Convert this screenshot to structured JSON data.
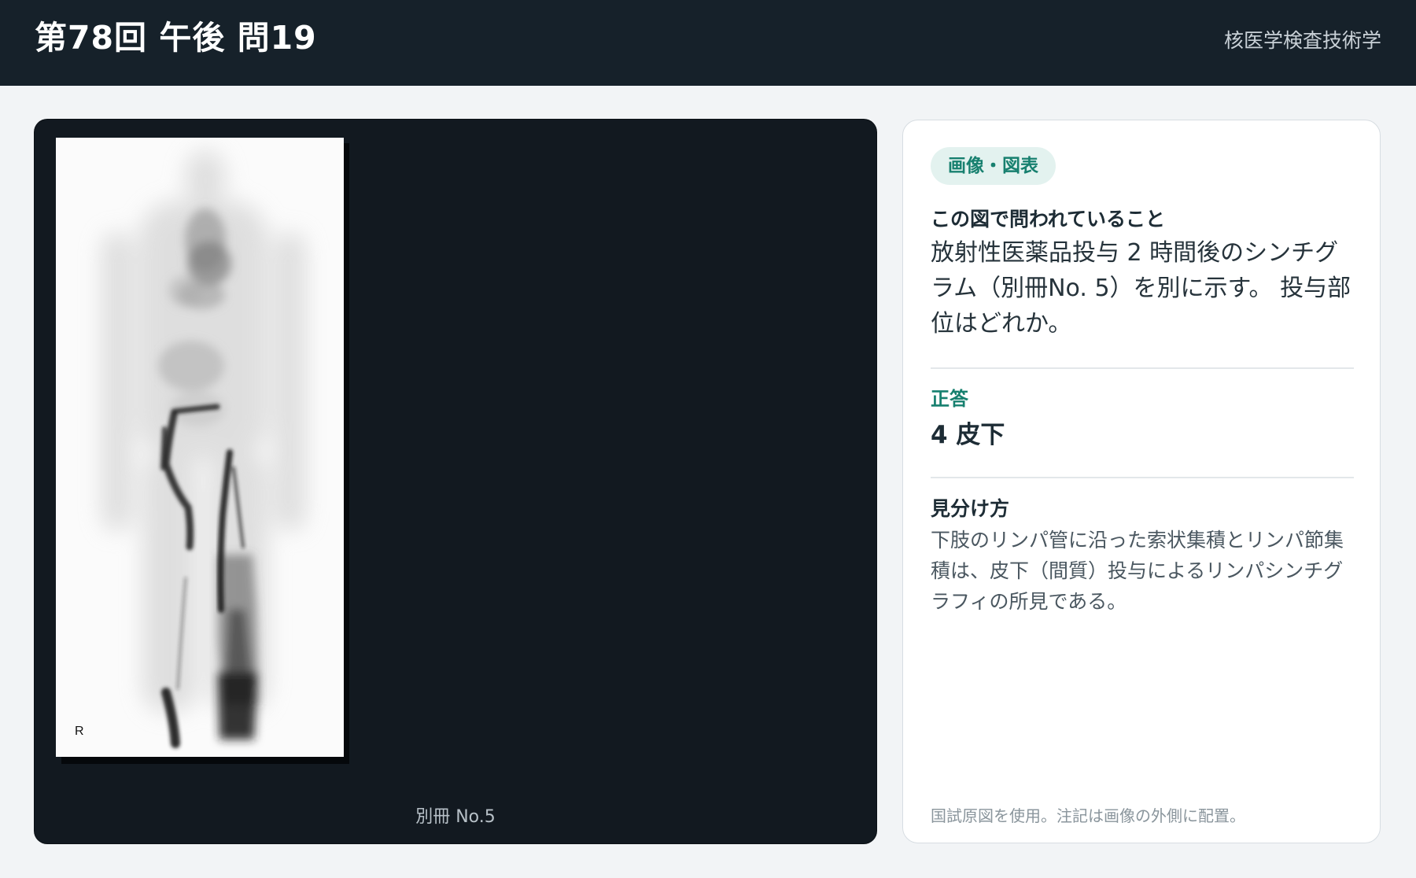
{
  "header": {
    "title": "第78回 午後 問19",
    "subject": "核医学検査技術学"
  },
  "viewer": {
    "film_marker": "R",
    "caption": "別冊 No.5"
  },
  "panel": {
    "badge": "画像・図表",
    "question_label": "この図で問われていること",
    "question_text": "放射性医薬品投与 2 時間後のシンチグラム（別冊No. 5）を別に示す。 投与部位はどれか。",
    "answer_label": "正答",
    "answer_text": "4 皮下",
    "tips_label": "見分け方",
    "tips_text": "下肢のリンパ管に沿った索状集積とリンパ節集積は、皮下（間質）投与によるリンパシンチグラフィの所見である。",
    "footnote": "国試原図を使用。注記は画像の外側に配置。"
  },
  "colors": {
    "header_bg": "#16212a",
    "accent": "#17806f",
    "viewer_bg": "#121920"
  }
}
